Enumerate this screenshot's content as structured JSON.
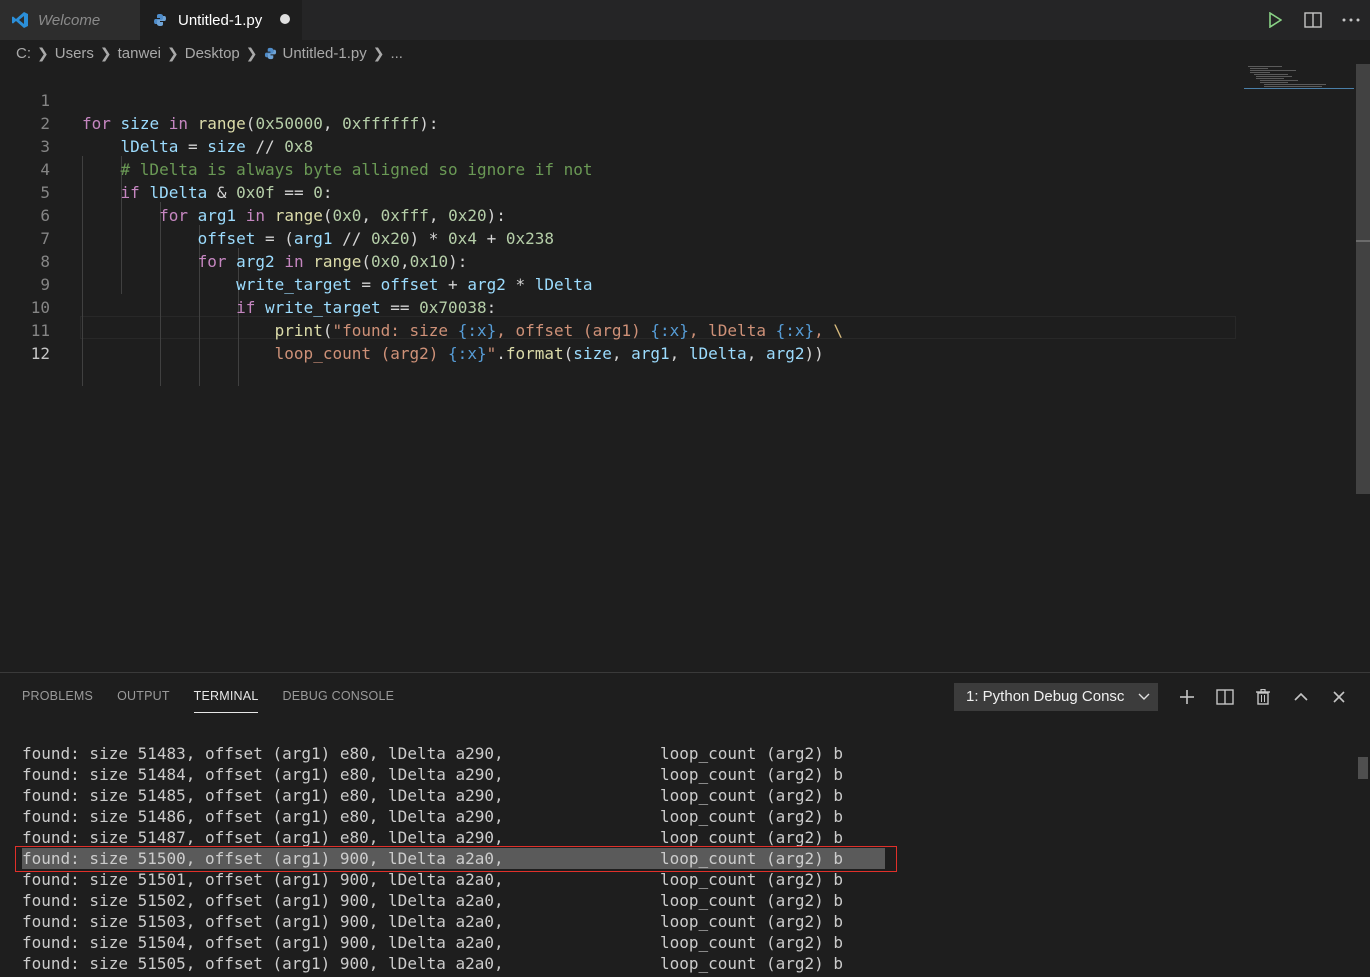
{
  "tabs": [
    {
      "label": "Welcome",
      "icon": "vscode-logo-icon",
      "active": false
    },
    {
      "label": "Untitled-1.py",
      "icon": "python-file-icon",
      "active": true,
      "dirty": true
    }
  ],
  "tab_actions": [
    "run-icon",
    "split-editor-icon",
    "more-actions-icon"
  ],
  "breadcrumb": {
    "parts": [
      "C:",
      "Users",
      "tanwei",
      "Desktop"
    ],
    "file": "Untitled-1.py",
    "tail": "..."
  },
  "editor": {
    "line_numbers": [
      "1",
      "2",
      "3",
      "4",
      "5",
      "6",
      "7",
      "8",
      "9",
      "10",
      "11",
      "12"
    ],
    "current_line": 12,
    "lines": [
      "for size in range(0x50000, 0xffffff):",
      "    lDelta = size // 0x8",
      "    # lDelta is always byte alligned so ignore if not",
      "    if lDelta & 0x0f == 0:",
      "        for arg1 in range(0x0, 0xfff, 0x20):",
      "            offset = (arg1 // 0x20) * 0x4 + 0x238",
      "            for arg2 in range(0x0,0x10):",
      "                write_target = offset + arg2 * lDelta",
      "                if write_target == 0x70038:",
      "                    print(\"found: size {:x}, offset (arg1) {:x}, lDelta {:x}, \\",
      "                    loop_count (arg2) {:x}\".format(size, arg1, lDelta, arg2))",
      ""
    ]
  },
  "panel": {
    "tabs": [
      "PROBLEMS",
      "OUTPUT",
      "TERMINAL",
      "DEBUG CONSOLE"
    ],
    "active_tab": "TERMINAL",
    "terminal_select": "1: Python Debug Consc",
    "actions": [
      "add-terminal-icon",
      "split-terminal-icon",
      "trash-icon",
      "maximize-panel-icon",
      "close-panel-icon"
    ]
  },
  "terminal": {
    "highlight_index": 5,
    "lines": [
      {
        "left": "found: size 51483, offset (arg1) e80, lDelta a290,",
        "right": "loop_count (arg2) b"
      },
      {
        "left": "found: size 51484, offset (arg1) e80, lDelta a290,",
        "right": "loop_count (arg2) b"
      },
      {
        "left": "found: size 51485, offset (arg1) e80, lDelta a290,",
        "right": "loop_count (arg2) b"
      },
      {
        "left": "found: size 51486, offset (arg1) e80, lDelta a290,",
        "right": "loop_count (arg2) b"
      },
      {
        "left": "found: size 51487, offset (arg1) e80, lDelta a290,",
        "right": "loop_count (arg2) b"
      },
      {
        "left": "found: size 51500, offset (arg1) 900, lDelta a2a0,",
        "right": "loop_count (arg2) b"
      },
      {
        "left": "found: size 51501, offset (arg1) 900, lDelta a2a0,",
        "right": "loop_count (arg2) b"
      },
      {
        "left": "found: size 51502, offset (arg1) 900, lDelta a2a0,",
        "right": "loop_count (arg2) b"
      },
      {
        "left": "found: size 51503, offset (arg1) 900, lDelta a2a0,",
        "right": "loop_count (arg2) b"
      },
      {
        "left": "found: size 51504, offset (arg1) 900, lDelta a2a0,",
        "right": "loop_count (arg2) b"
      },
      {
        "left": "found: size 51505, offset (arg1) 900, lDelta a2a0,",
        "right": "loop_count (arg2) b"
      }
    ]
  },
  "colors": {
    "keyword": "#c586c0",
    "function": "#dcdcaa",
    "number": "#b5cea8",
    "string": "#ce9178",
    "comment": "#6a9955",
    "highlight_border": "#e0302a"
  }
}
